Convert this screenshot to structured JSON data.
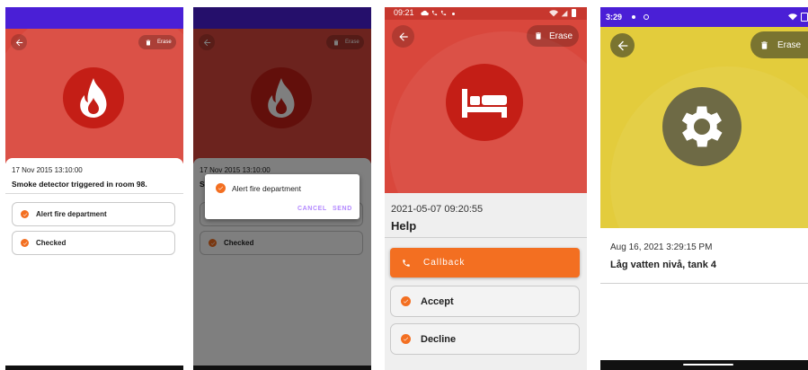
{
  "colors": {
    "status_purple": "#4a1fd6",
    "red_header": "#d9473c",
    "icon_red": "#c41e16",
    "yellow_header": "#e3cc3c",
    "olive": "#7a7430",
    "gear_circle": "#6e6a45",
    "orange": "#f36f21",
    "gray_sheet": "#efefef"
  },
  "screen1": {
    "header_icon": "fire-icon",
    "erase_label": "Erase",
    "timestamp": "17 Nov 2015 13:10:00",
    "title": "Smoke detector triggered in room 98.",
    "actions": [
      {
        "label": "Alert fire department",
        "icon": "check-circle-icon"
      },
      {
        "label": "Checked",
        "icon": "check-circle-icon"
      }
    ]
  },
  "screen2": {
    "erase_label": "Erase",
    "timestamp": "17 Nov 2015 13:10:00",
    "title_fragment": "S",
    "actions": [
      {
        "label": "Checked"
      }
    ],
    "dialog": {
      "label": "Alert fire department",
      "cancel": "CANCEL",
      "send": "SEND"
    }
  },
  "screen3": {
    "status_time": "09:21",
    "header_icon": "bed-icon",
    "erase_label": "Erase",
    "timestamp": "2021-05-07 09:20:55",
    "title": "Help",
    "primary_action": "Callback",
    "actions": [
      {
        "label": "Accept"
      },
      {
        "label": "Decline"
      }
    ]
  },
  "screen4": {
    "status_time": "3:29",
    "header_icon": "gear-icon",
    "erase_label": "Erase",
    "timestamp": "Aug 16, 2021 3:29:15 PM",
    "title": "Låg vatten nivå, tank 4"
  }
}
